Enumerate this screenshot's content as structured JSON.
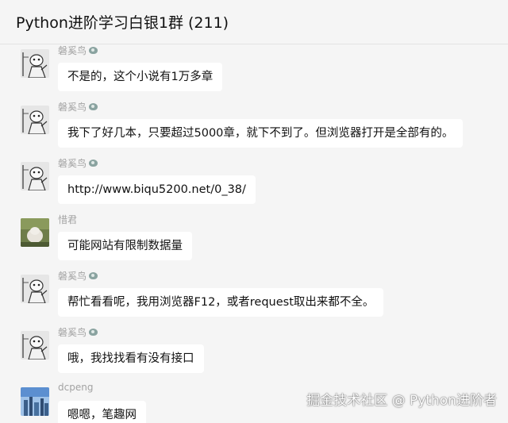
{
  "header": {
    "title": "Python进阶学习白银1群 (211)"
  },
  "messages": [
    {
      "sender": "磐奚鸟",
      "level_icon": "level-badge-icon",
      "avatar": "cartoon-avatar",
      "text": "不是的，这个小说有1万多章"
    },
    {
      "sender": "磐奚鸟",
      "level_icon": "level-badge-icon",
      "avatar": "cartoon-avatar",
      "text": "我下了好几本，只要超过5000章，就下不到了。但浏览器打开是全部有的。"
    },
    {
      "sender": "磐奚鸟",
      "level_icon": "level-badge-icon",
      "avatar": "cartoon-avatar",
      "text": "http://www.biqu5200.net/0_38/"
    },
    {
      "sender": "惜君",
      "avatar": "photo-avatar",
      "text": "可能网站有限制数据量"
    },
    {
      "sender": "磐奚鸟",
      "level_icon": "level-badge-icon",
      "avatar": "cartoon-avatar",
      "text": "帮忙看看呢，我用浏览器F12，或者request取出来都不全。"
    },
    {
      "sender": "磐奚鸟",
      "level_icon": "level-badge-icon",
      "avatar": "cartoon-avatar",
      "text": "哦，我找找看有没有接口"
    },
    {
      "sender": "dcpeng",
      "avatar": "city-avatar",
      "text": "嗯嗯，笔趣网"
    }
  ],
  "watermark": "掘金技术社区 @ Python进阶者",
  "colors": {
    "background": "#f5f5f5",
    "bubble": "#ffffff",
    "sender_name": "#a3a3a3"
  }
}
